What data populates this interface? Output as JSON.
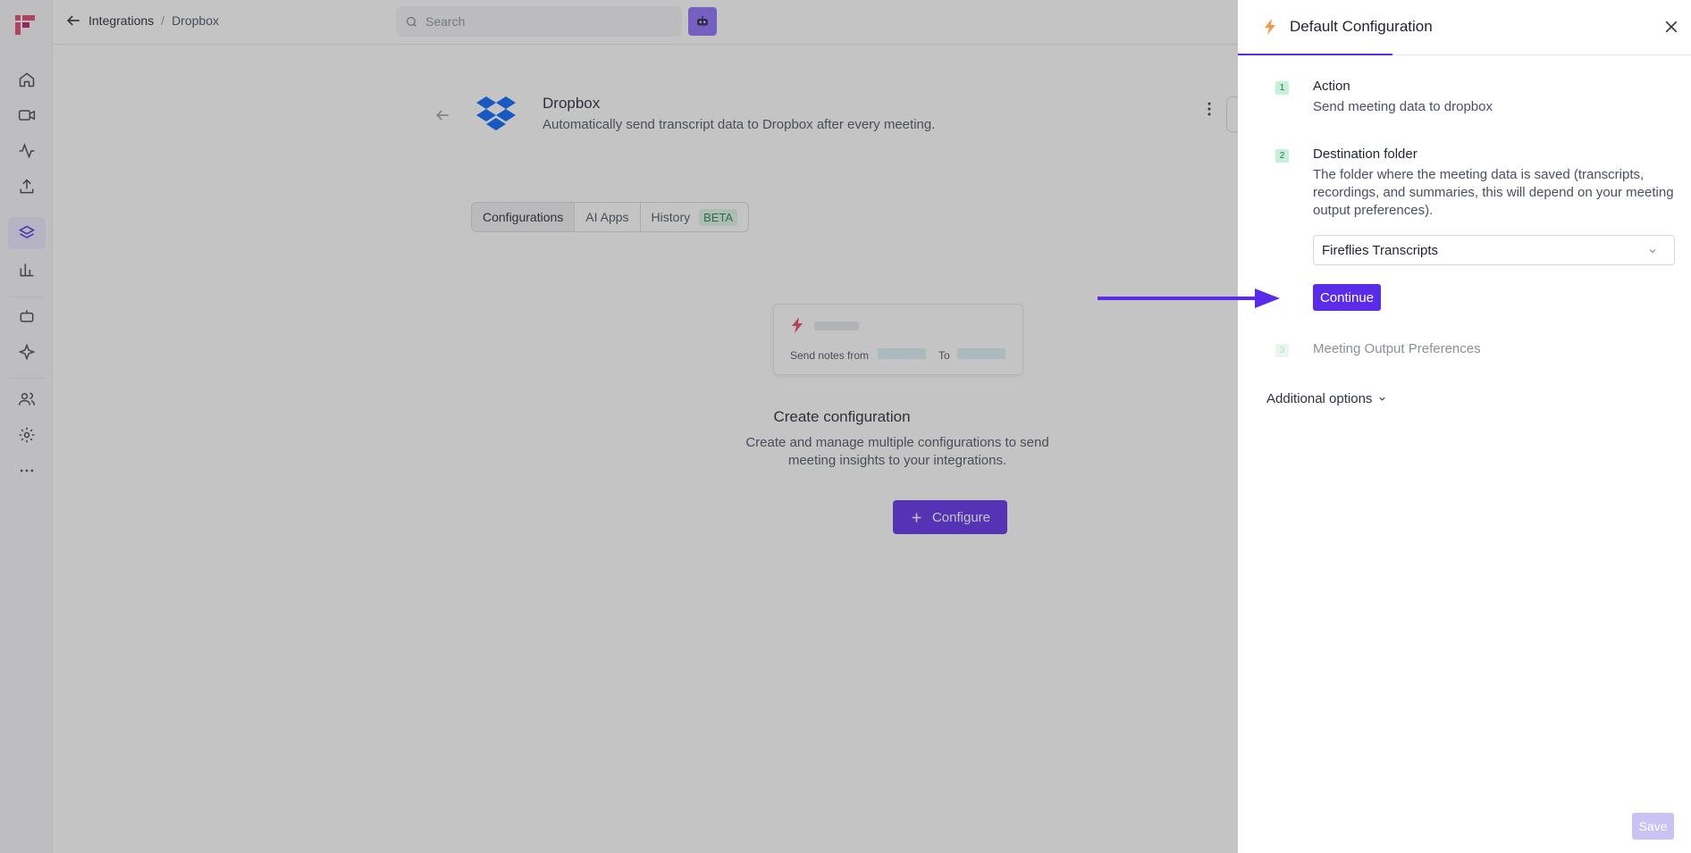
{
  "breadcrumb": {
    "parent": "Integrations",
    "separator": "/",
    "current": "Dropbox"
  },
  "search": {
    "placeholder": "Search"
  },
  "integration": {
    "title": "Dropbox",
    "description": "Automatically send transcript data to Dropbox after every meeting."
  },
  "tabs": [
    {
      "label": "Configurations"
    },
    {
      "label": "AI Apps"
    },
    {
      "label": "History",
      "badge": "BETA"
    }
  ],
  "illustration": {
    "send_label": "Send notes from",
    "to_label": "To"
  },
  "empty_state": {
    "title": "Create configuration",
    "description": "Create and manage multiple configurations to send meeting insights to your integrations.",
    "button_label": "Configure"
  },
  "panel": {
    "title": "Default Configuration",
    "steps": [
      {
        "number": "1",
        "title": "Action",
        "subtitle": "Send meeting data to dropbox"
      },
      {
        "number": "2",
        "title": "Destination folder",
        "subtitle": "The folder where the meeting data is saved (transcripts, recordings, and summaries, this will depend on your meeting output preferences)."
      },
      {
        "number": "3",
        "title": "Meeting Output Preferences"
      }
    ],
    "folder_select": {
      "value": "Fireflies Transcripts"
    },
    "continue_label": "Continue",
    "additional_label": "Additional options",
    "save_label": "Save"
  },
  "colors": {
    "accent": "#5a2be8",
    "arrow": "#5a2be8",
    "beta": "#1e7a4e"
  }
}
